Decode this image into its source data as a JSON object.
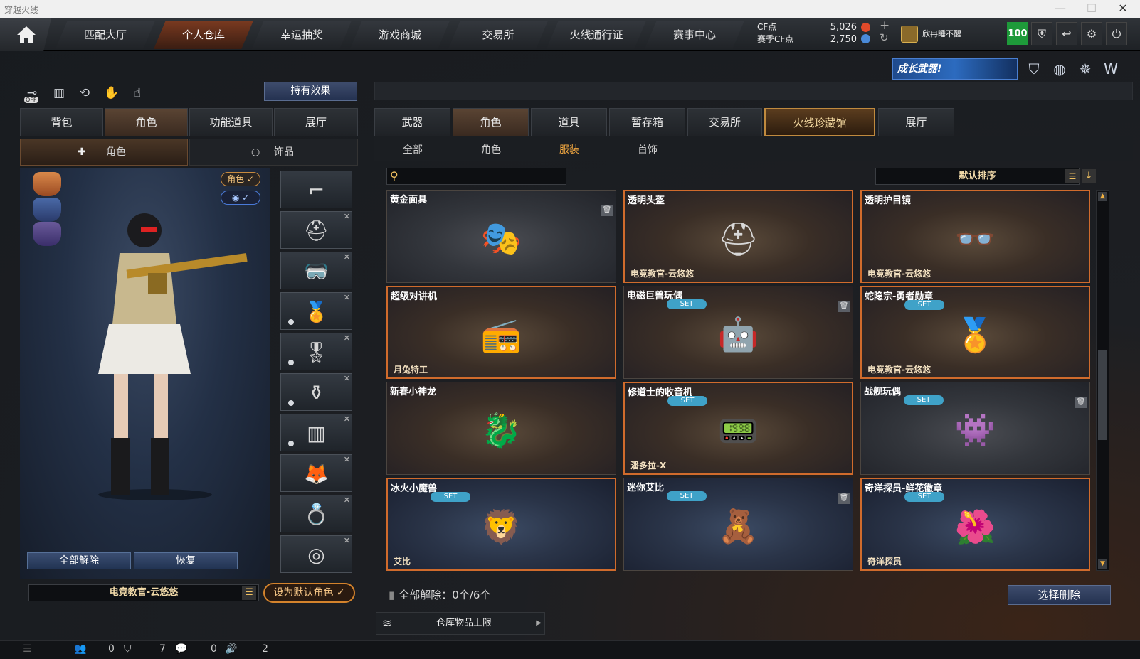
{
  "window": {
    "title": "穿越火线",
    "minimize": "—",
    "maximize": "☐",
    "close": "✕"
  },
  "nav": {
    "tabs": [
      "匹配大厅",
      "个人仓库",
      "幸运抽奖",
      "游戏商城",
      "交易所",
      "火线通行证",
      "赛事中心"
    ],
    "active_index": 1
  },
  "currency": {
    "cf_label": "CF点",
    "season_label": "赛季CF点",
    "cf_value": "5,026",
    "season_value": "2,750",
    "plus": "+",
    "refresh": "↻"
  },
  "user": {
    "name": "欣冉睡不醒",
    "level": "100"
  },
  "banner": {
    "text": "成长武器!"
  },
  "left": {
    "effect_button": "持有效果",
    "off_label": "OFF",
    "tabs": [
      "背包",
      "角色",
      "功能道具",
      "展厅"
    ],
    "active_tab": 1,
    "subtabs": [
      "角色",
      "饰品"
    ],
    "pill_role": "角色 ✓",
    "pill_eye": "◉ ✓",
    "reset_all": "全部解除",
    "restore": "恢复",
    "char_name": "电竞教官-云悠悠",
    "set_default": "设为默认角色 ✓"
  },
  "right": {
    "tabs": [
      "武器",
      "角色",
      "道具",
      "暂存箱",
      "交易所",
      "火线珍藏馆",
      "展厅"
    ],
    "active_tab": 1,
    "subtabs": [
      "全部",
      "角色",
      "服装",
      "首饰"
    ],
    "active_sub": 2,
    "sort_label": "默认排序",
    "items": [
      {
        "name": "黄金面具",
        "owner": "",
        "set": false,
        "trash": true,
        "style": "gray",
        "icon": "mask-icon",
        "glyph": "🎭"
      },
      {
        "name": "透明头盔",
        "owner": "电竞教官-云悠悠",
        "set": false,
        "trash": false,
        "style": "orange",
        "icon": "helmet-icon",
        "glyph": "⛑"
      },
      {
        "name": "透明护目镜",
        "owner": "电竞教官-云悠悠",
        "set": false,
        "trash": false,
        "style": "orange",
        "icon": "goggles-icon",
        "glyph": "👓"
      },
      {
        "name": "超级对讲机",
        "owner": "月兔特工",
        "set": false,
        "trash": false,
        "style": "orange",
        "icon": "radio-icon",
        "glyph": "📻"
      },
      {
        "name": "电磁巨兽玩偶",
        "owner": "",
        "set": true,
        "trash": true,
        "style": "normal",
        "icon": "robot-toy-icon",
        "glyph": "🤖"
      },
      {
        "name": "蛇隐宗-勇者勋章",
        "owner": "电竞教官-云悠悠",
        "set": true,
        "trash": false,
        "style": "orange",
        "icon": "medal-icon",
        "glyph": "🏅"
      },
      {
        "name": "新春小神龙",
        "owner": "",
        "set": false,
        "trash": false,
        "style": "normal",
        "icon": "dragon-icon",
        "glyph": "🐉"
      },
      {
        "name": "修道士的收音机",
        "owner": "潘多拉-X",
        "set": true,
        "trash": false,
        "style": "orange",
        "icon": "walkie-icon",
        "glyph": "📟"
      },
      {
        "name": "战舰玩偶",
        "owner": "",
        "set": true,
        "trash": true,
        "style": "gray",
        "icon": "doll-icon",
        "glyph": "👾"
      },
      {
        "name": "冰火小魔兽",
        "owner": "艾比",
        "set": true,
        "trash": false,
        "style": "blue-orange",
        "icon": "beast-icon",
        "glyph": "🦁"
      },
      {
        "name": "迷你艾比",
        "owner": "",
        "set": true,
        "trash": true,
        "style": "blue",
        "icon": "mini-figure-icon",
        "glyph": "🧸"
      },
      {
        "name": "奇洋探员-鲜花徽章",
        "owner": "奇洋探员",
        "set": true,
        "trash": false,
        "style": "blue-orange",
        "icon": "flower-badge-icon",
        "glyph": "🌺"
      }
    ],
    "set_label": "SET",
    "dismiss_text": "全部解除：0个/6个",
    "select_delete": "选择删除",
    "capacity": "仓库物品上限"
  },
  "status": {
    "friends": "0",
    "clan": "7",
    "chat": "0",
    "volume": "2"
  }
}
